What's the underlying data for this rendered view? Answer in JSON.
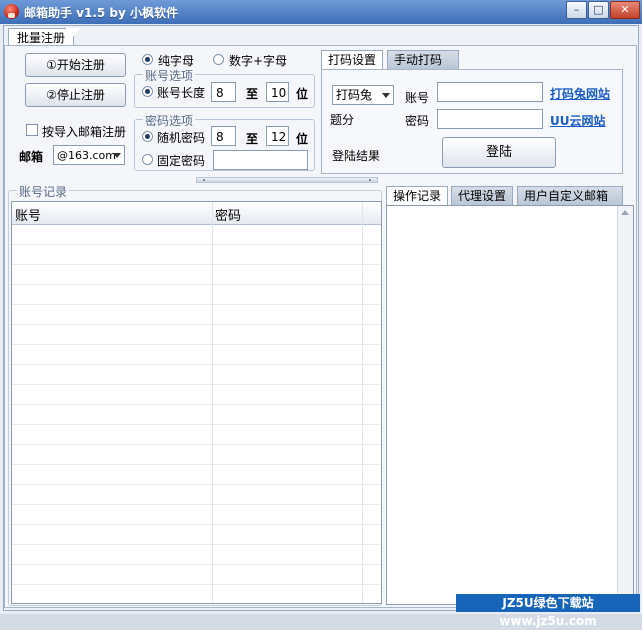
{
  "window": {
    "title": "邮箱助手 v1.5 by 小枫软件",
    "minimize": "–",
    "maximize": "□",
    "close": "✕"
  },
  "main_tab": "批量注册",
  "register": {
    "start_button": "①开始注册",
    "stop_button": "②停止注册",
    "import_checkbox": "按导入邮箱注册",
    "mailbox_label": "邮箱",
    "mailbox_value": "@163.com",
    "charset_pure": "纯字母",
    "charset_mixed": "数字+字母",
    "account_group": "账号选项",
    "account_length_label": "账号长度",
    "account_min": "8",
    "account_to": "至",
    "account_max": "10",
    "account_unit": "位",
    "password_group": "密码选项",
    "random_password_label": "随机密码",
    "password_min": "8",
    "password_to": "至",
    "password_max": "12",
    "password_unit": "位",
    "fixed_password_label": "固定密码",
    "fixed_password_value": ""
  },
  "captcha": {
    "tab_settings": "打码设置",
    "tab_manual": "手动打码",
    "service_value": "打码兔",
    "account_label": "账号",
    "password_label": "密码",
    "score_label": "题分",
    "login_result_label": "登陆结果",
    "login_button": "登陆",
    "link_dama2": "打码兔网站",
    "link_uu": "UU云网站"
  },
  "records": {
    "group_title": "账号记录",
    "columns": [
      "账号",
      "密码"
    ],
    "rows": []
  },
  "log_tabs": [
    "操作记录",
    "代理设置",
    "用户自定义邮箱"
  ],
  "watermark": "JZ5U绿色下载站www.jz5u.com"
}
